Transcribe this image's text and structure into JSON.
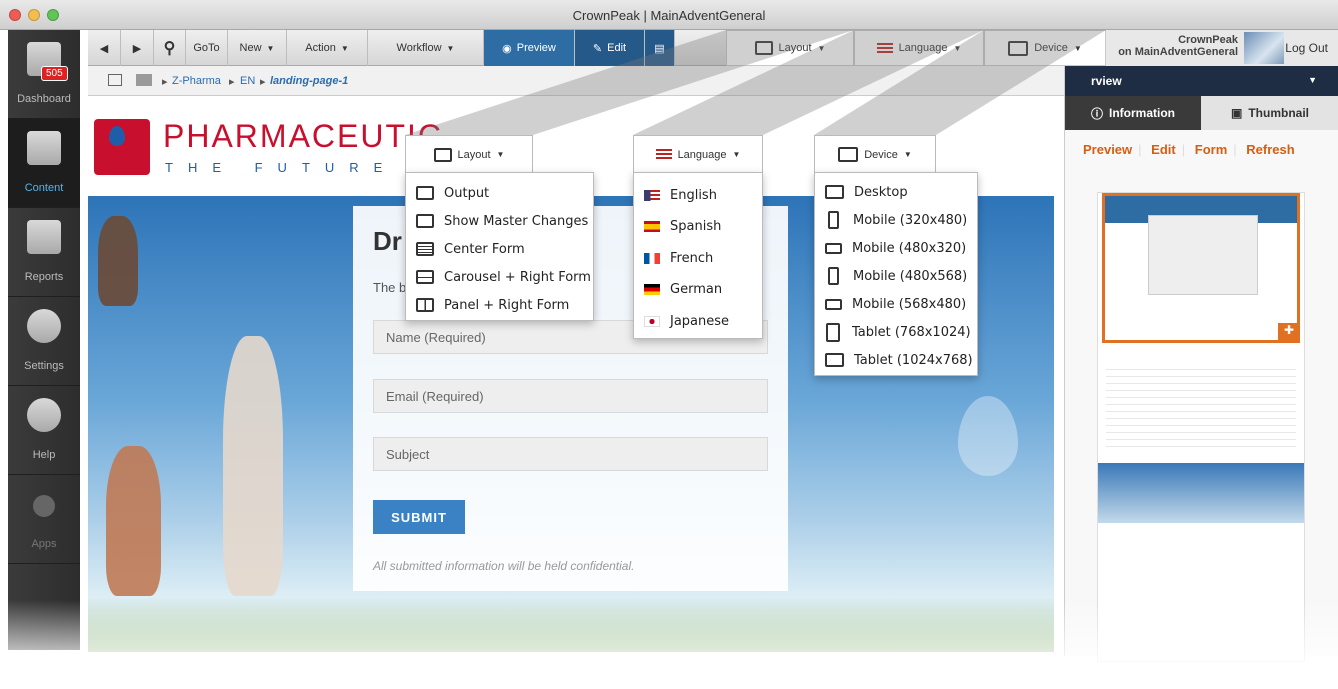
{
  "window": {
    "title": "CrownPeak | MainAdventGeneral"
  },
  "sidebar": {
    "items": [
      {
        "label": "Dashboard",
        "badge": "505"
      },
      {
        "label": "Content"
      },
      {
        "label": "Reports"
      },
      {
        "label": "Settings"
      },
      {
        "label": "Help"
      },
      {
        "label": "Apps"
      }
    ]
  },
  "toolbar": {
    "goto": "GoTo",
    "new": "New",
    "action": "Action",
    "workflow": "Workflow",
    "preview": "Preview",
    "edit": "Edit",
    "layout": "Layout",
    "language": "Language",
    "device": "Device"
  },
  "user": {
    "name": "CrownPeak",
    "site": "on MainAdventGeneral",
    "logout": "Log Out"
  },
  "breadcrumb": {
    "items": [
      "Z-Pharma",
      "EN",
      "landing-page-1"
    ]
  },
  "page": {
    "logo_text": "PHARMACEUTIC",
    "logo_tagline": "THE FUTURE IS",
    "form_title": "Dr",
    "form_intro": "The b",
    "fields": [
      "Name (Required)",
      "Email (Required)",
      "Subject"
    ],
    "submit": "SUBMIT",
    "confidential": "All submitted information will be held confidential."
  },
  "right_panel": {
    "title": "rview",
    "tabs": [
      "Information",
      "Thumbnail"
    ],
    "links": [
      "Preview",
      "Edit",
      "Form",
      "Refresh"
    ]
  },
  "menus": {
    "layout": {
      "label": "Layout",
      "items": [
        "Output",
        "Show Master Changes",
        "Center Form",
        "Carousel + Right Form",
        "Panel + Right Form"
      ]
    },
    "language": {
      "label": "Language",
      "items": [
        "English",
        "Spanish",
        "French",
        "German",
        "Japanese"
      ]
    },
    "device": {
      "label": "Device",
      "items": [
        "Desktop",
        "Mobile (320x480)",
        "Mobile (480x320)",
        "Mobile (480x568)",
        "Mobile (568x480)",
        "Tablet (768x1024)",
        "Tablet (1024x768)"
      ]
    }
  },
  "colors": {
    "accent_blue": "#2e6da4",
    "accent_orange": "#d95d0e",
    "brand_red": "#c8102e"
  }
}
